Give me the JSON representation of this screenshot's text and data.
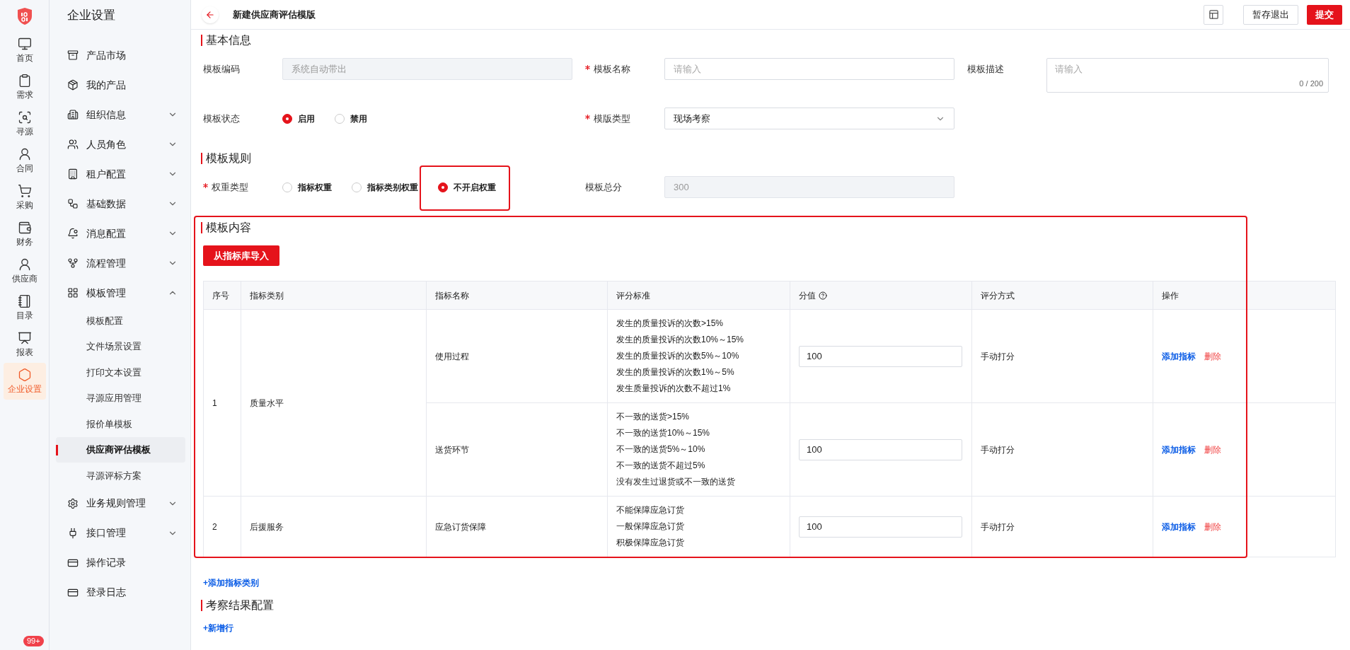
{
  "rail": {
    "items": [
      {
        "label": "首页",
        "selected": false
      },
      {
        "label": "需求",
        "selected": false
      },
      {
        "label": "寻源",
        "selected": false
      },
      {
        "label": "合同",
        "selected": false
      },
      {
        "label": "采购",
        "selected": false
      },
      {
        "label": "财务",
        "selected": false
      },
      {
        "label": "供应商",
        "selected": false
      },
      {
        "label": "目录",
        "selected": false
      },
      {
        "label": "报表",
        "selected": false
      },
      {
        "label": "企业设置",
        "selected": true
      }
    ],
    "badge": "99+"
  },
  "sidebar": {
    "title": "企业设置",
    "items": [
      {
        "label": "产品市场",
        "kind": "link"
      },
      {
        "label": "我的产品",
        "kind": "link"
      },
      {
        "label": "组织信息",
        "kind": "group",
        "expanded": false
      },
      {
        "label": "人员角色",
        "kind": "group",
        "expanded": false
      },
      {
        "label": "租户配置",
        "kind": "group",
        "expanded": false
      },
      {
        "label": "基础数据",
        "kind": "group",
        "expanded": false
      },
      {
        "label": "消息配置",
        "kind": "group",
        "expanded": false
      },
      {
        "label": "流程管理",
        "kind": "group",
        "expanded": false
      },
      {
        "label": "模板管理",
        "kind": "group",
        "expanded": true,
        "children": [
          {
            "label": "模板配置",
            "selected": false
          },
          {
            "label": "文件场景设置",
            "selected": false
          },
          {
            "label": "打印文本设置",
            "selected": false
          },
          {
            "label": "寻源应用管理",
            "selected": false
          },
          {
            "label": "报价单模板",
            "selected": false
          },
          {
            "label": "供应商评估模板",
            "selected": true
          },
          {
            "label": "寻源评标方案",
            "selected": false
          }
        ]
      },
      {
        "label": "业务规则管理",
        "kind": "group",
        "expanded": false
      },
      {
        "label": "接口管理",
        "kind": "group",
        "expanded": false
      },
      {
        "label": "操作记录",
        "kind": "link"
      },
      {
        "label": "登录日志",
        "kind": "link"
      }
    ]
  },
  "header": {
    "title": "新建供应商评估模版",
    "buttons": [
      {
        "label": "暂存退出",
        "kind": "secondary"
      },
      {
        "label": "提交",
        "kind": "primary"
      }
    ]
  },
  "basic_info": {
    "title": "基本信息",
    "fields": [
      {
        "label": "模板编码",
        "required": false,
        "kind": "input",
        "value": "系统自动带出",
        "disabled": true
      },
      {
        "label": "模板名称",
        "required": true,
        "kind": "input",
        "placeholder": "请输入",
        "disabled": false
      },
      {
        "label": "模板描述",
        "required": false,
        "kind": "textarea",
        "placeholder": "请输入",
        "counter": "0 / 200"
      },
      {
        "label": "模板状态",
        "required": false,
        "kind": "radio",
        "options": [
          {
            "label": "启用",
            "selected": true
          },
          {
            "label": "禁用",
            "selected": false
          }
        ]
      },
      {
        "label": "模版类型",
        "required": true,
        "kind": "select",
        "value": "现场考察"
      }
    ]
  },
  "rules": {
    "title": "模板规则",
    "fields": [
      {
        "label": "权重类型",
        "required": true,
        "kind": "radio",
        "options": [
          {
            "label": "指标权重",
            "selected": false,
            "highlighted": false
          },
          {
            "label": "指标类别权重",
            "selected": false,
            "highlighted": false
          },
          {
            "label": "不开启权重",
            "selected": true,
            "highlighted": true
          }
        ]
      },
      {
        "label": "模板总分",
        "required": false,
        "kind": "input",
        "value": "300",
        "disabled": true
      }
    ]
  },
  "content": {
    "title": "模板内容",
    "highlighted": true,
    "import_button": "从指标库导入",
    "table": {
      "columns": [
        {
          "label": "序号",
          "help": false
        },
        {
          "label": "指标类别",
          "help": false
        },
        {
          "label": "指标名称",
          "help": false
        },
        {
          "label": "评分标准",
          "help": false
        },
        {
          "label": "分值",
          "help": true
        },
        {
          "label": "评分方式",
          "help": false
        },
        {
          "label": "操作",
          "help": false
        }
      ],
      "rows": [
        {
          "index": "1",
          "category": "质量水平",
          "indicators": [
            {
              "name": "使用过程",
              "criteria": [
                "发生的质量投诉的次数>15%",
                "发生的质量投诉的次数10%～15%",
                "发生的质量投诉的次数5%～10%",
                "发生的质量投诉的次数1%～5%",
                "发生质量投诉的次数不超过1%"
              ],
              "score": "100",
              "method": "手动打分",
              "actions": [
                {
                  "label": "添加指标",
                  "kind": "add"
                },
                {
                  "label": "删除",
                  "kind": "delete"
                }
              ]
            },
            {
              "name": "送货环节",
              "criteria": [
                "不一致的送货>15%",
                "不一致的送货10%～15%",
                "不一致的送货5%～10%",
                "不一致的送货不超过5%",
                "没有发生过退货或不一致的送货"
              ],
              "score": "100",
              "method": "手动打分",
              "actions": [
                {
                  "label": "添加指标",
                  "kind": "add"
                },
                {
                  "label": "删除",
                  "kind": "delete"
                }
              ]
            }
          ]
        },
        {
          "index": "2",
          "category": "后援服务",
          "indicators": [
            {
              "name": "应急订货保障",
              "criteria": [
                "不能保障应急订货",
                "一般保障应急订货",
                "积极保障应急订货"
              ],
              "score": "100",
              "method": "手动打分",
              "actions": [
                {
                  "label": "添加指标",
                  "kind": "add"
                },
                {
                  "label": "删除",
                  "kind": "delete"
                }
              ]
            }
          ]
        }
      ]
    }
  },
  "add_category_link": "+添加指标类别",
  "result_config": {
    "title": "考察结果配置",
    "add_row_link": "+新增行"
  }
}
